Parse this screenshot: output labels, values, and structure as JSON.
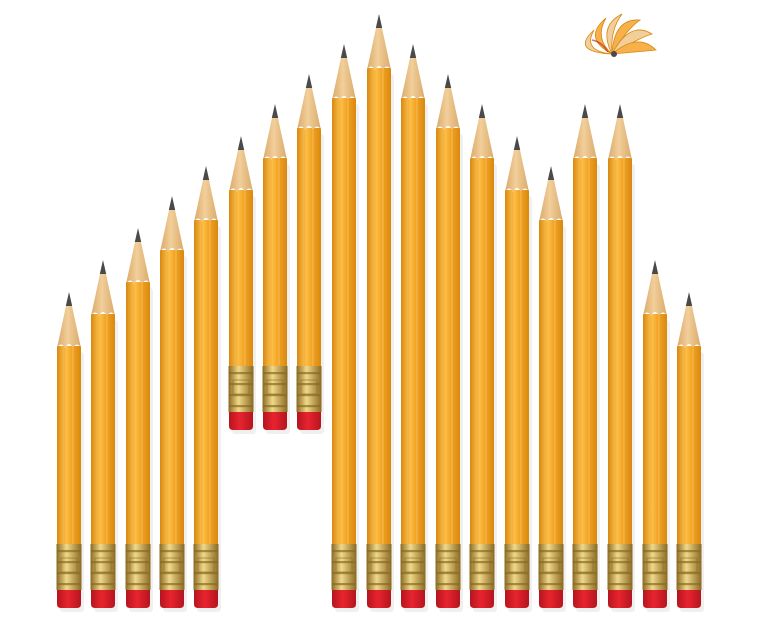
{
  "scene": {
    "subject": "pencil-arrangement",
    "colors": {
      "background": "#ffffff",
      "body": "#f5a623",
      "body_light": "#fcc24e",
      "body_dark": "#d98810",
      "wood": "#f2cf9a",
      "wood_dark": "#d9a96a",
      "graphite": "#4a4a4a",
      "ferrule": "#c9a24a",
      "ferrule_dark": "#8a6a22",
      "eraser": "#e8242f",
      "eraser_dark": "#b5151f",
      "shaving": "#f6b14a"
    },
    "pencils": [
      {
        "name": "pencil-01"
      },
      {
        "name": "pencil-02"
      },
      {
        "name": "pencil-03"
      },
      {
        "name": "pencil-04"
      },
      {
        "name": "pencil-05"
      },
      {
        "name": "pencil-06"
      },
      {
        "name": "pencil-07"
      },
      {
        "name": "pencil-08"
      },
      {
        "name": "pencil-09"
      },
      {
        "name": "pencil-10"
      },
      {
        "name": "pencil-11"
      },
      {
        "name": "pencil-12"
      },
      {
        "name": "pencil-13"
      },
      {
        "name": "pencil-14"
      },
      {
        "name": "pencil-15"
      },
      {
        "name": "pencil-16"
      },
      {
        "name": "pencil-17"
      },
      {
        "name": "pencil-18"
      },
      {
        "name": "pencil-19"
      },
      {
        "name": "pencil-20"
      }
    ],
    "shavings": {
      "name": "pencil-shavings"
    }
  }
}
